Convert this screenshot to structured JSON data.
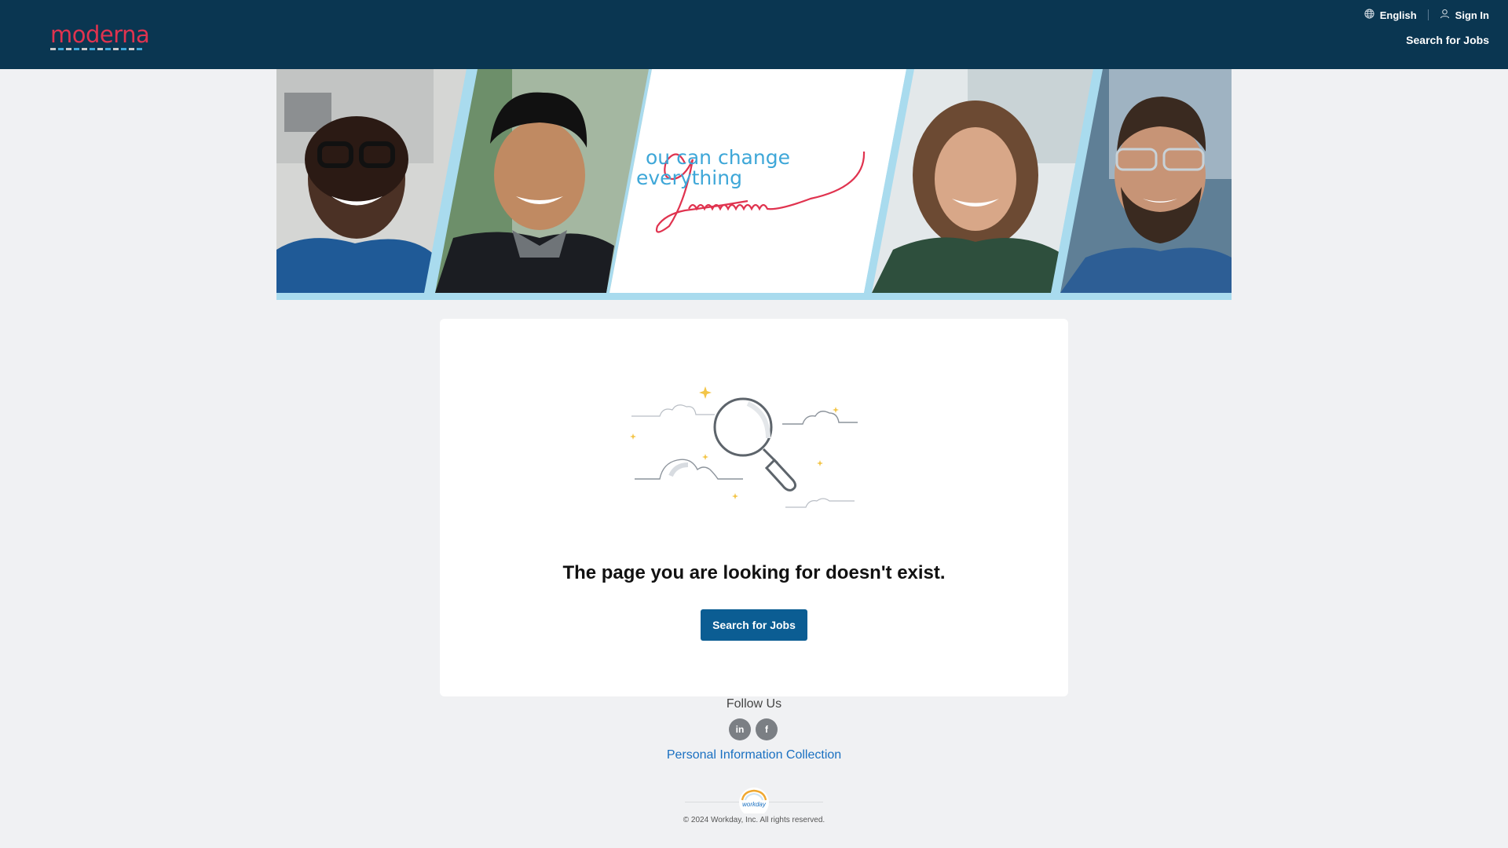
{
  "header": {
    "logo": "moderna",
    "language_label": "English",
    "sign_in_label": "Sign In",
    "nav_search_label": "Search for Jobs"
  },
  "banner": {
    "tagline_part1": "ou can change",
    "tagline_part2": "everything",
    "tagline_script_letter": "y"
  },
  "main": {
    "message": "The page you are looking for doesn't exist.",
    "search_button_label": "Search for Jobs"
  },
  "footer": {
    "follow_us": "Follow Us",
    "social": [
      {
        "name": "linkedin",
        "glyph": "in"
      },
      {
        "name": "facebook",
        "glyph": "f"
      }
    ],
    "privacy_link": "Personal Information Collection",
    "workday_logo": "workday",
    "copyright": "© 2024 Workday, Inc. All rights reserved."
  },
  "colors": {
    "header_bg": "#0a3651",
    "brand_red": "#e0334f",
    "brand_blue": "#3ea7d8",
    "button_bg": "#0b5d93",
    "link": "#1a70c1",
    "page_bg": "#f0f1f3"
  }
}
